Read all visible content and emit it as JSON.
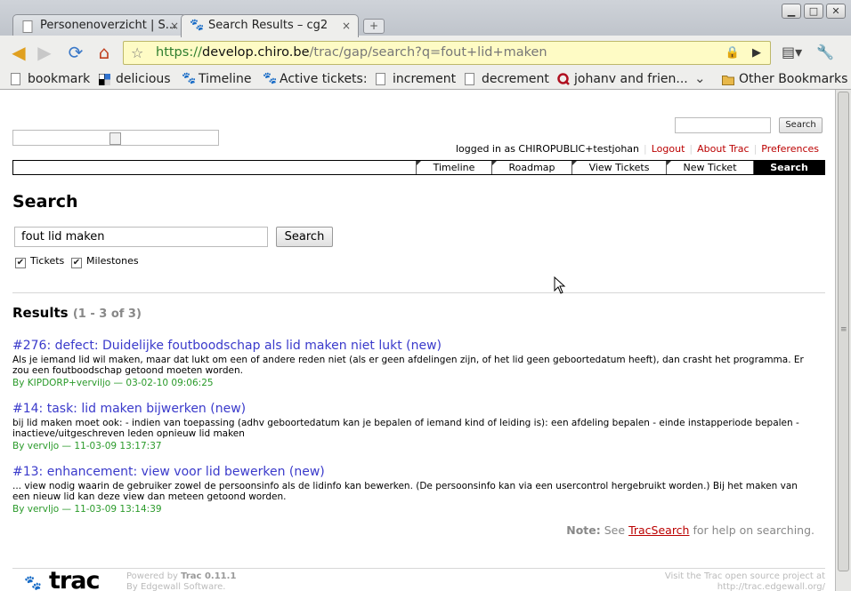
{
  "browser": {
    "tabs": [
      {
        "title": "Personenoverzicht | S...",
        "active": false
      },
      {
        "title": "Search Results – cg2",
        "active": true
      }
    ],
    "close_glyph": "×",
    "new_tab_glyph": "+",
    "window_buttons": {
      "minimize": "▁",
      "maximize": "□",
      "close": "✕"
    },
    "url": {
      "scheme": "https://",
      "host": "develop.chiro.be",
      "path": "/trac/gap/search?q=fout+lid+maken"
    },
    "bookmarks": [
      {
        "label": "bookmark",
        "icon": "document-icon"
      },
      {
        "label": "delicious",
        "icon": "delicious-icon"
      },
      {
        "label": "Timeline",
        "icon": "trac-paw-icon"
      },
      {
        "label": "Active tickets:",
        "icon": "trac-paw-icon"
      },
      {
        "label": "increment",
        "icon": "document-icon"
      },
      {
        "label": "decrement",
        "icon": "document-icon"
      },
      {
        "label": "johanv and frien...",
        "icon": "q-icon"
      }
    ],
    "other_bookmarks": "Other Bookmarks",
    "colors": {
      "url_scheme": "#2e7d2e",
      "omnibox_bg": "#fefbc5"
    }
  },
  "header": {
    "top_search_button": "Search",
    "metanav": {
      "logged_in": "logged in as CHIROPUBLIC+testjohan",
      "logout": "Logout",
      "about": "About Trac",
      "preferences": "Preferences"
    }
  },
  "mainnav": [
    {
      "label": "Timeline",
      "active": false
    },
    {
      "label": "Roadmap",
      "active": false
    },
    {
      "label": "View Tickets",
      "active": false
    },
    {
      "label": "New Ticket",
      "active": false
    },
    {
      "label": "Search",
      "active": true
    }
  ],
  "search": {
    "title": "Search",
    "query": "fout lid maken",
    "button": "Search",
    "filters": [
      {
        "label": "Tickets",
        "checked": true
      },
      {
        "label": "Milestones",
        "checked": true
      }
    ],
    "check_glyph": "✔"
  },
  "results": {
    "heading": "Results",
    "range": "(1 - 3 of 3)",
    "items": [
      {
        "title": "#276: defect: Duidelijke foutboodschap als lid maken niet lukt (new)",
        "excerpt": "Als je iemand lid wil maken, maar dat lukt om een of andere reden niet (als er geen afdelingen zijn, of het lid geen geboortedatum heeft), dan crasht het programma. Er zou een foutboodschap getoond moeten worden.",
        "meta": "By KIPDORP+verviljo — 03-02-10 09:06:25"
      },
      {
        "title": "#14: task: lid maken bijwerken (new)",
        "excerpt": "bij lid maken moet ook: - indien van toepassing (adhv geboortedatum kan je bepalen of iemand kind of leiding is): een afdeling bepalen - einde instapperiode bepalen - inactieve/uitgeschreven leden opnieuw lid maken",
        "meta": "By vervljo — 11-03-09 13:17:37"
      },
      {
        "title": "#13: enhancement: view voor lid bewerken (new)",
        "excerpt": "... view nodig waarin de gebruiker zowel de persoonsinfo als de lidinfo kan bewerken. (De persoonsinfo kan via een usercontrol hergebruikt worden.) Bij het maken van een nieuw lid kan deze view dan meteen getoond worden.",
        "meta": "By vervljo — 11-03-09 13:14:39"
      }
    ]
  },
  "note": {
    "label": "Note:",
    "pre": "See",
    "link": "TracSearch",
    "post": "for help on searching."
  },
  "footer": {
    "logo_text": "trac",
    "powered_prefix": "Powered by",
    "powered_product": "Trac 0.11.1",
    "powered_by2": "By Edgewall Software.",
    "visit_line1": "Visit the Trac open source project at",
    "visit_line2": "http://trac.edgewall.org/"
  }
}
